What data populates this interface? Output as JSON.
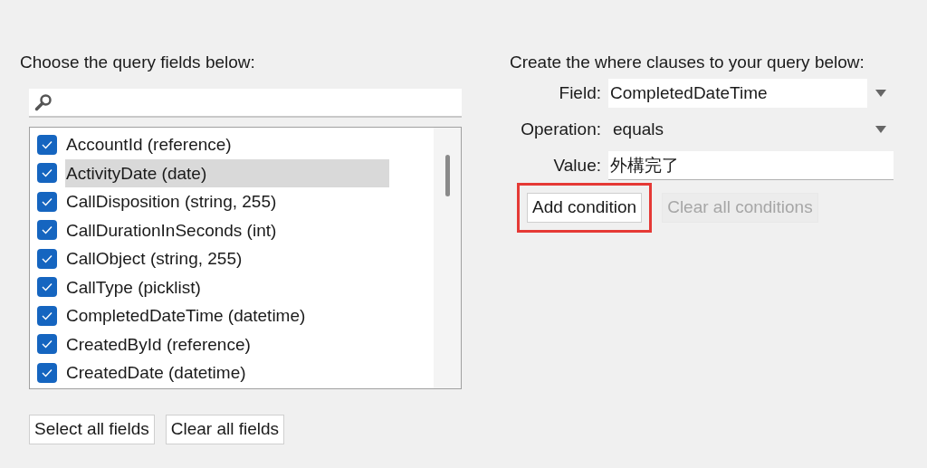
{
  "left": {
    "heading": "Choose the query fields below:",
    "fields": [
      {
        "label": "AccountId (reference)",
        "checked": true,
        "selected": false
      },
      {
        "label": "ActivityDate (date)",
        "checked": true,
        "selected": true
      },
      {
        "label": "CallDisposition (string, 255)",
        "checked": true,
        "selected": false
      },
      {
        "label": "CallDurationInSeconds (int)",
        "checked": true,
        "selected": false
      },
      {
        "label": "CallObject (string, 255)",
        "checked": true,
        "selected": false
      },
      {
        "label": "CallType (picklist)",
        "checked": true,
        "selected": false
      },
      {
        "label": "CompletedDateTime (datetime)",
        "checked": true,
        "selected": false
      },
      {
        "label": "CreatedById (reference)",
        "checked": true,
        "selected": false
      },
      {
        "label": "CreatedDate (datetime)",
        "checked": true,
        "selected": false
      }
    ],
    "buttons": [
      {
        "label": "Select all fields",
        "disabled": false
      },
      {
        "label": "Clear all fields",
        "disabled": false
      }
    ]
  },
  "right": {
    "heading": "Create the where clauses to your query below:",
    "rows": [
      {
        "kind": "dropdown",
        "label": "Field:",
        "value": "CompletedDateTime"
      },
      {
        "kind": "dropdown",
        "label": "Operation:",
        "value": "equals"
      },
      {
        "kind": "text",
        "label": "Value:",
        "value": "外構完了"
      }
    ],
    "buttons": [
      {
        "label": "Add condition",
        "disabled": false,
        "highlighted": true
      },
      {
        "label": "Clear all conditions",
        "disabled": true,
        "highlighted": false
      }
    ]
  }
}
